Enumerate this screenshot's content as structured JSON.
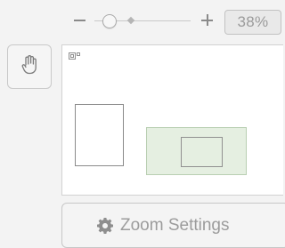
{
  "zoom": {
    "value_label": "38%",
    "level": 0.38,
    "minus_icon": "minus-icon",
    "plus_icon": "plus-icon"
  },
  "tools": {
    "hand_icon": "hand-icon"
  },
  "minimap": {
    "icon": "minimap-icon"
  },
  "settings": {
    "label": "Zoom Settings",
    "icon": "gear-icon"
  }
}
